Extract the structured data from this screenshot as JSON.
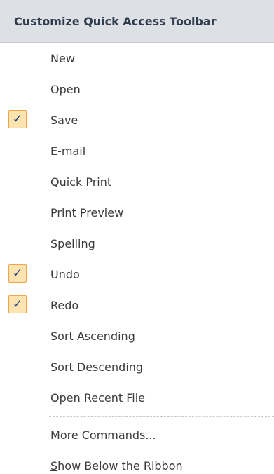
{
  "menu": {
    "title": "Customize Quick Access Toolbar",
    "check_glyph": "✓",
    "items": [
      {
        "label": "New",
        "checked": false
      },
      {
        "label": "Open",
        "checked": false
      },
      {
        "label": "Save",
        "checked": true
      },
      {
        "label": "E-mail",
        "checked": false
      },
      {
        "label": "Quick Print",
        "checked": false
      },
      {
        "label": "Print Preview",
        "checked": false
      },
      {
        "label": "Spelling",
        "checked": false
      },
      {
        "label": "Undo",
        "checked": true
      },
      {
        "label": "Redo",
        "checked": true
      },
      {
        "label": "Sort Ascending",
        "checked": false
      },
      {
        "label": "Sort Descending",
        "checked": false
      },
      {
        "label": "Open Recent File",
        "checked": false
      }
    ],
    "more_commands": {
      "first": "M",
      "rest": "ore Commands..."
    },
    "show_below": {
      "first": "S",
      "rest": "how Below the Ribbon"
    }
  },
  "colors": {
    "header_bg": "#dde0e4",
    "check_bg": "#fde3b0",
    "check_border": "#f2a44a",
    "check_mark": "#1d3f80"
  }
}
